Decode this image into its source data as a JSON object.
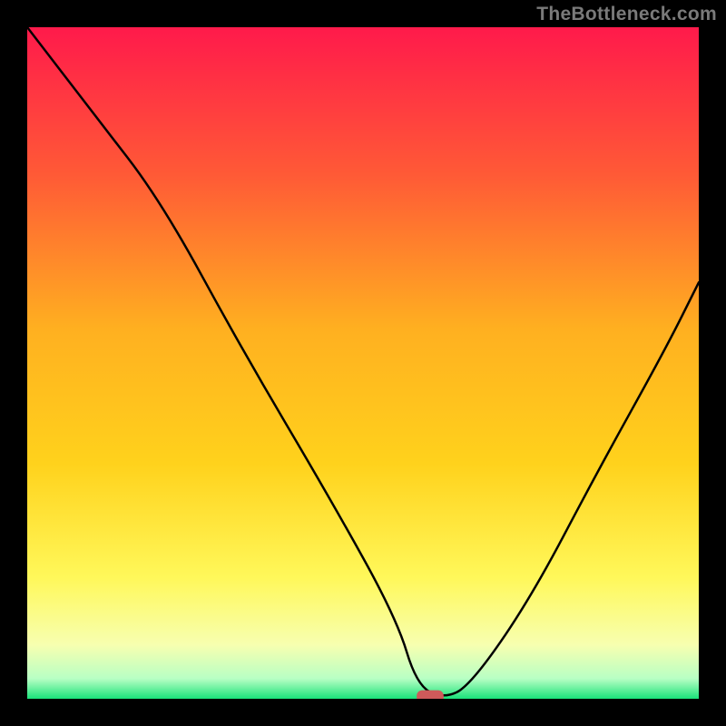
{
  "watermark": "TheBottleneck.com",
  "colors": {
    "bg": "#000000",
    "border": "#000000",
    "curve": "#000000",
    "watermark": "#7a7a7a",
    "marker": "#cf5a5a",
    "gradient_top": "#ff1a4b",
    "gradient_mid_upper": "#ff8a2b",
    "gradient_mid": "#ffd21c",
    "gradient_mid_lower": "#fff85a",
    "gradient_lower": "#f7ffb0",
    "gradient_bottom": "#19e27a"
  },
  "chart_data": {
    "type": "line",
    "title": "",
    "xlabel": "",
    "ylabel": "",
    "xlim": [
      0,
      100
    ],
    "ylim": [
      0,
      100
    ],
    "grid": false,
    "legend": false,
    "series": [
      {
        "name": "bottleneck-curve",
        "x": [
          0,
          10,
          20,
          32,
          45,
          55,
          58,
          62,
          66,
          75,
          85,
          95,
          100
        ],
        "values": [
          100,
          87,
          74,
          52,
          30,
          12,
          2,
          0,
          2,
          15,
          34,
          52,
          62
        ]
      }
    ],
    "marker": {
      "x": 60,
      "y": 0,
      "width": 4,
      "height": 2
    },
    "annotations": []
  }
}
